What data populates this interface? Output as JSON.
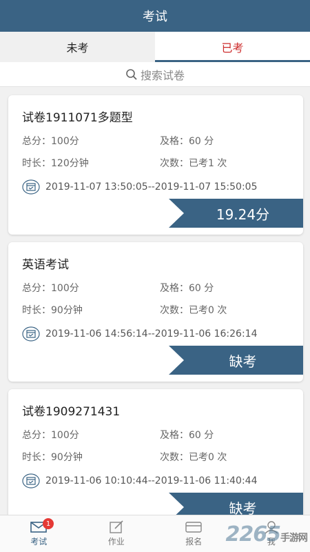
{
  "header": {
    "title": "考试"
  },
  "tabs": [
    {
      "label": "未考",
      "active": false
    },
    {
      "label": "已考",
      "active": true
    }
  ],
  "search": {
    "placeholder": "搜索试卷"
  },
  "exams": [
    {
      "title": "试卷1911071多题型",
      "total": "总分：100分",
      "pass": "及格：60 分",
      "duration": "时长：120分钟",
      "attempts": "次数：已考1 次",
      "time": "2019-11-07 13:50:05--2019-11-07 15:50:05",
      "result": "19.24分"
    },
    {
      "title": "英语考试",
      "total": "总分：100分",
      "pass": "及格：60 分",
      "duration": "时长：90分钟",
      "attempts": "次数：已考0 次",
      "time": "2019-11-06 14:56:14--2019-11-06 16:26:14",
      "result": "缺考"
    },
    {
      "title": "试卷1909271431",
      "total": "总分：100分",
      "pass": "及格：60 分",
      "duration": "时长：90分钟",
      "attempts": "次数：已考0 次",
      "time": "2019-11-06 10:10:44--2019-11-06 11:40:44",
      "result": "缺考"
    }
  ],
  "bottom_nav": [
    {
      "label": "考试",
      "icon": "mail-icon",
      "active": true,
      "badge": "1"
    },
    {
      "label": "作业",
      "icon": "edit-icon",
      "active": false
    },
    {
      "label": "报名",
      "icon": "card-icon",
      "active": false
    },
    {
      "label": "我",
      "icon": "user-icon",
      "active": false
    }
  ],
  "watermark": {
    "text": "2265",
    "sub": "手游网"
  },
  "colors": {
    "primary": "#3a6384",
    "active_tab": "#cc2a2a",
    "badge": "#e53935"
  }
}
